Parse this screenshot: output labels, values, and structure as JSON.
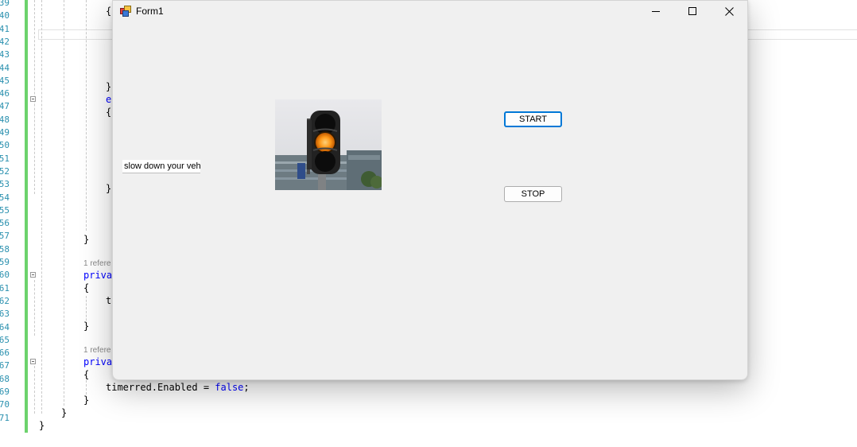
{
  "editor": {
    "line_numbers": [
      "39",
      "40",
      "41",
      "42",
      "43",
      "44",
      "45",
      "46",
      "47",
      "48",
      "49",
      "50",
      "51",
      "52",
      "53",
      "54",
      "55",
      "56",
      "57",
      "58",
      "59",
      "60",
      "61",
      "62",
      "63",
      "64",
      "65",
      "66",
      "67",
      "68",
      "69",
      "70",
      "71"
    ],
    "code": {
      "brace_open_1": "{",
      "brace_close_1": "}",
      "else_kw": "e",
      "brace_open_2": "{",
      "brace_close_2": "}",
      "brace_close_3": "}",
      "ref_1": "1 refere",
      "private_1": "priva",
      "brace_open_3": "{",
      "t_fragment": "t",
      "brace_close_4": "}",
      "ref_2": "1 refere",
      "private_2": "priva",
      "brace_open_4": "{",
      "stmt_prefix": "timerred.Enabled = ",
      "stmt_kw": "false",
      "stmt_suffix": ";",
      "brace_close_5": "}",
      "brace_close_6": "}",
      "brace_close_7": "}"
    }
  },
  "form": {
    "title": "Form1",
    "icon": "winforms-app-icon",
    "controls": {
      "minimize": "minimize-icon",
      "maximize": "maximize-icon",
      "close": "close-icon"
    },
    "label_text": "slow down your veh",
    "picture": "traffic-light-amber",
    "start_label": "START",
    "stop_label": "STOP",
    "colors": {
      "form_bg": "#f0f0f0",
      "focus_border": "#0078d7",
      "amber_light": "#ff9a1a"
    }
  }
}
